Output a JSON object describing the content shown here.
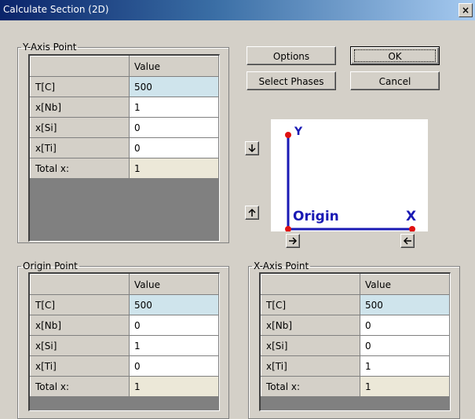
{
  "window": {
    "title": "Calculate Section (2D)",
    "close_glyph": "×"
  },
  "buttons": {
    "options": "Options",
    "ok": "OK",
    "select_phases": "Select Phases",
    "cancel": "Cancel"
  },
  "table_header": "Value",
  "y_axis_point": {
    "legend": "Y-Axis Point",
    "rows": [
      {
        "label": "T[C]",
        "value": "500"
      },
      {
        "label": "x[Nb]",
        "value": "1"
      },
      {
        "label": "x[Si]",
        "value": "0"
      },
      {
        "label": "x[Ti]",
        "value": "0"
      },
      {
        "label": "Total x:",
        "value": "1"
      }
    ]
  },
  "origin_point": {
    "legend": "Origin Point",
    "rows": [
      {
        "label": "T[C]",
        "value": "500"
      },
      {
        "label": "x[Nb]",
        "value": "0"
      },
      {
        "label": "x[Si]",
        "value": "1"
      },
      {
        "label": "x[Ti]",
        "value": "0"
      },
      {
        "label": "Total x:",
        "value": "1"
      }
    ]
  },
  "x_axis_point": {
    "legend": "X-Axis Point",
    "rows": [
      {
        "label": "T[C]",
        "value": "500"
      },
      {
        "label": "x[Nb]",
        "value": "0"
      },
      {
        "label": "x[Si]",
        "value": "0"
      },
      {
        "label": "x[Ti]",
        "value": "1"
      },
      {
        "label": "Total x:",
        "value": "1"
      }
    ]
  },
  "axis_diagram": {
    "y_label": "Y",
    "x_label": "X",
    "origin_label": "Origin",
    "axis_color": "#1a1ab4",
    "point_color": "#e01010"
  },
  "arrow_buttons": [
    "arrow-down-icon",
    "arrow-up-icon",
    "arrow-right-icon",
    "arrow-left-icon"
  ]
}
